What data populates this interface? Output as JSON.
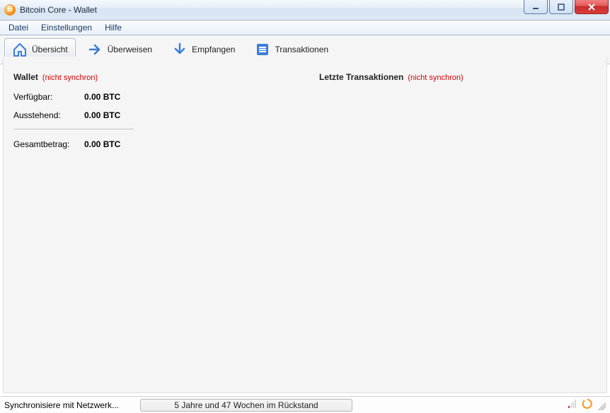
{
  "window": {
    "title": "Bitcoin Core - Wallet"
  },
  "menu": {
    "file": "Datei",
    "settings": "Einstellungen",
    "help": "Hilfe"
  },
  "toolbar": {
    "overview": "Übersicht",
    "send": "Überweisen",
    "receive": "Empfangen",
    "transactions": "Transaktionen"
  },
  "overview": {
    "wallet_header": "Wallet",
    "out_of_sync": "(nicht synchron)",
    "available_label": "Verfügbar:",
    "available_value": "0.00 BTC",
    "pending_label": "Ausstehend:",
    "pending_value": "0.00 BTC",
    "total_label": "Gesamtbetrag:",
    "total_value": "0.00 BTC",
    "recent_tx_header": "Letzte Transaktionen"
  },
  "status": {
    "sync_label": "Synchronisiere mit Netzwerk...",
    "progress_text": "5 Jahre und 47 Wochen im Rückstand"
  },
  "colors": {
    "accent": "#f7931a",
    "warning": "#d40000",
    "toolbar_blue": "#3b7dd8"
  }
}
